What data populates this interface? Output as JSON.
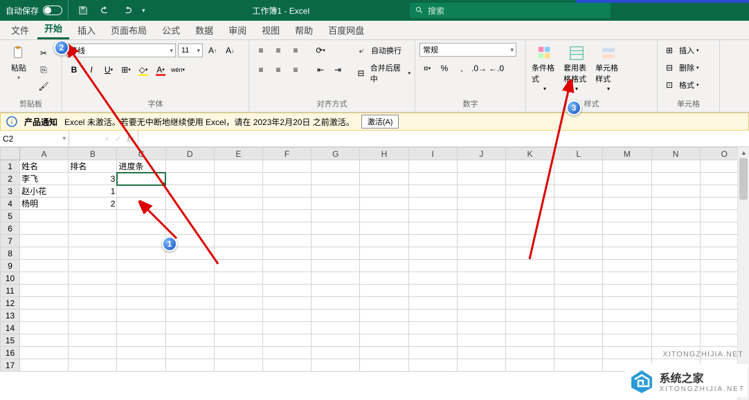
{
  "titlebar": {
    "autosave": "自动保存",
    "doc_title": "工作簿1 - Excel",
    "search_placeholder": "搜索"
  },
  "tabs": {
    "file": "文件",
    "home": "开始",
    "insert": "插入",
    "layout": "页面布局",
    "formula": "公式",
    "data": "数据",
    "review": "审阅",
    "view": "视图",
    "help": "帮助",
    "baidu": "百度网盘"
  },
  "ribbon": {
    "clipboard": {
      "paste": "粘贴",
      "group": "剪贴板"
    },
    "font": {
      "name": "等线",
      "size": "11",
      "group": "字体"
    },
    "alignment": {
      "wrap": "自动换行",
      "merge": "合并后居中",
      "group": "对齐方式"
    },
    "number": {
      "format": "常规",
      "group": "数字"
    },
    "styles": {
      "cond": "条件格式",
      "table": "套用表格格式",
      "cell": "单元格样式",
      "group": "样式"
    },
    "cells": {
      "insert": "插入",
      "delete": "删除",
      "format": "格式",
      "group": "单元格"
    }
  },
  "notice": {
    "title": "产品通知",
    "text": "Excel 未激活。若要无中断地继续使用 Excel，请在 2023年2月20日 之前激活。",
    "button": "激活(A)"
  },
  "fxbar": {
    "cell": "C2",
    "fx": "fx"
  },
  "columns": [
    "A",
    "B",
    "C",
    "D",
    "E",
    "F",
    "G",
    "H",
    "I",
    "J",
    "K",
    "L",
    "M",
    "N",
    "O"
  ],
  "rows_count": 17,
  "cells": {
    "A1": "姓名",
    "B1": "排名",
    "C1": "进度条",
    "A2": "李飞",
    "B2": "3",
    "A3": "赵小花",
    "B3": "1",
    "A4": "杨明",
    "B4": "2"
  },
  "selected": "C2",
  "markers": {
    "m1": "1",
    "m2": "2",
    "m3": "3"
  },
  "watermark": "XITONGZHIJIA.NET",
  "logo": {
    "title": "系统之家",
    "sub": "XITONGZHIJIA.NET"
  }
}
